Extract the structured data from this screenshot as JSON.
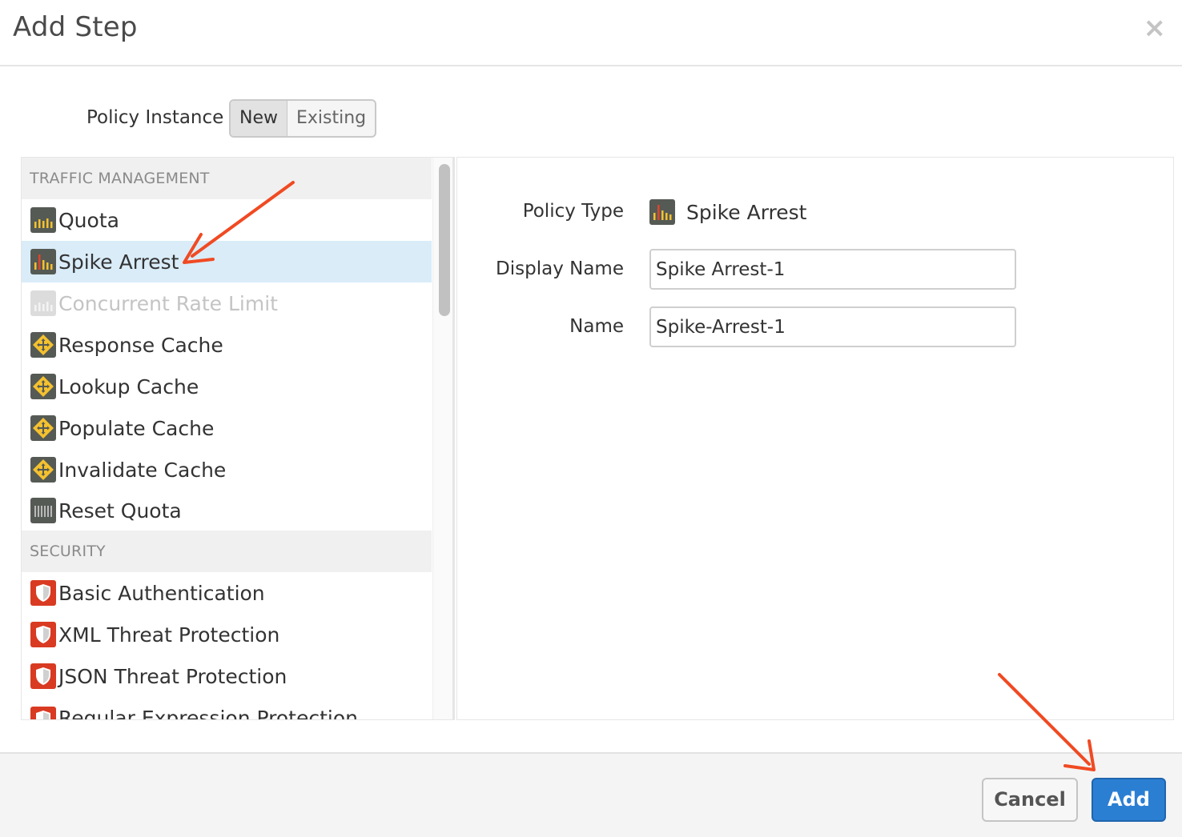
{
  "dialog": {
    "title": "Add Step",
    "close_glyph": "×"
  },
  "policy_instance": {
    "label": "Policy Instance",
    "options": [
      "New",
      "Existing"
    ],
    "selected": "New"
  },
  "categories": [
    {
      "name": "TRAFFIC MANAGEMENT",
      "items": [
        {
          "label": "Quota",
          "icon": "quota-icon"
        },
        {
          "label": "Spike Arrest",
          "icon": "spike-arrest-icon",
          "selected": true
        },
        {
          "label": "Concurrent Rate Limit",
          "icon": "concurrent-rate-limit-icon",
          "disabled": true
        },
        {
          "label": "Response Cache",
          "icon": "cache-icon"
        },
        {
          "label": "Lookup Cache",
          "icon": "cache-icon"
        },
        {
          "label": "Populate Cache",
          "icon": "cache-icon"
        },
        {
          "label": "Invalidate Cache",
          "icon": "cache-icon"
        },
        {
          "label": "Reset Quota",
          "icon": "reset-quota-icon"
        }
      ]
    },
    {
      "name": "SECURITY",
      "items": [
        {
          "label": "Basic Authentication",
          "icon": "shield-icon"
        },
        {
          "label": "XML Threat Protection",
          "icon": "shield-icon"
        },
        {
          "label": "JSON Threat Protection",
          "icon": "shield-icon"
        },
        {
          "label": "Regular Expression Protection",
          "icon": "shield-icon"
        }
      ]
    }
  ],
  "form": {
    "policy_type_label": "Policy Type",
    "policy_type_value": "Spike Arrest",
    "display_name_label": "Display Name",
    "display_name_value": "Spike Arrest-1",
    "name_label": "Name",
    "name_value": "Spike-Arrest-1"
  },
  "footer": {
    "cancel_label": "Cancel",
    "add_label": "Add"
  },
  "colors": {
    "accent": "#2b7fd3",
    "selected_row": "#d9ecf8",
    "annotation_arrow": "#f04a23",
    "cache_icon": "#f5c12e",
    "shield_icon": "#d93a22"
  }
}
